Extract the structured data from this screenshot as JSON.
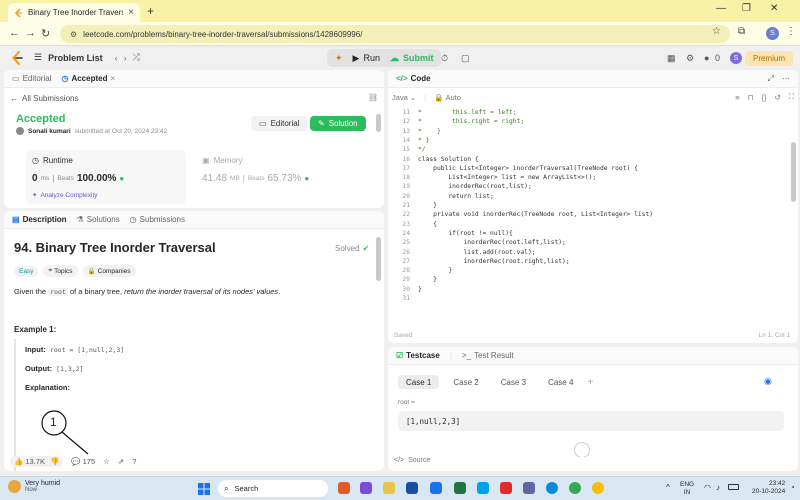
{
  "browser": {
    "tab_title": "Binary Tree Inorder Traversal",
    "url": "leetcode.com/problems/binary-tree-inorder-traversal/submissions/1428609996/",
    "avatar_letter": "S",
    "tab_close": "×",
    "new_tab": "+",
    "win_min": "—",
    "win_max": "❐",
    "win_close": "✕"
  },
  "lc_header": {
    "problem_list": "Problem List",
    "run": "Run",
    "submit": "Submit",
    "coins": "0",
    "premium": "Premium",
    "avatar_letter": "S"
  },
  "submission": {
    "tabs": [
      "Editorial",
      "Accepted"
    ],
    "tab_close": "×",
    "back_link": "All Submissions",
    "status": "Accepted",
    "author": "Sonali kumari",
    "submitted_text": "submitted at Oct 20, 2024 23:42",
    "editorial_btn": "Editorial",
    "solution_btn": "Solution",
    "runtime_label": "Runtime",
    "runtime_value": "0",
    "runtime_unit": "ms",
    "beats_label": "Beats",
    "runtime_beats": "100.00%",
    "analyze": "Analyze Complexity",
    "memory_label": "Memory",
    "memory_value": "41.48",
    "memory_unit": "MB",
    "memory_beats": "65.73%"
  },
  "description": {
    "tabs": [
      "Description",
      "Solutions",
      "Submissions"
    ],
    "title": "94. Binary Tree Inorder Traversal",
    "solved": "Solved",
    "tags": [
      "Easy",
      "Topics",
      "Companies"
    ],
    "stmt_1": "Given the",
    "stmt_code": "root",
    "stmt_2": "of a binary tree,",
    "stmt_3": "return the inorder traversal of its nodes' values",
    "stmt_4": ".",
    "example_title": "Example 1:",
    "input_label": "Input:",
    "input_value": "root = [1,null,2,3]",
    "output_label": "Output:",
    "output_value": "[1,3,2]",
    "explanation_label": "Explanation:",
    "tree_node": "1",
    "likes": "13.7K",
    "comments": "175"
  },
  "code": {
    "title": "Code",
    "language": "Java",
    "mode": "Auto",
    "status_saved": "Saved",
    "cursor": "Ln 1, Col 1",
    "line_numbers": [
      "11",
      "12",
      "13",
      "14",
      "15",
      "16",
      "17",
      "18",
      "19",
      "20",
      "21",
      "22",
      "23",
      "24",
      "25",
      "26",
      "27",
      "28",
      "29",
      "30",
      "31"
    ],
    "lines": [
      "*        this.left = left;",
      "*        this.right = right;",
      "*    }",
      "* }",
      "*/",
      "class Solution {",
      "    public List<Integer> inorderTraversal(TreeNode root) {",
      "        List<Integer> list = new ArrayList<>();",
      "        inorderRec(root,list);",
      "        return list;",
      "    }",
      "    private void inorderRec(TreeNode root, List<Integer> list)",
      "    {",
      "        if(root != null){",
      "            inorderRec(root.left,list);",
      "            list.add(root.val);",
      "            inorderRec(root.right,list);",
      "        }",
      "    }",
      "}",
      ""
    ]
  },
  "testcase": {
    "tab_testcase": "Testcase",
    "tab_result": "Test Result",
    "cases": [
      "Case 1",
      "Case 2",
      "Case 3",
      "Case 4"
    ],
    "add_case": "+",
    "var_label": "root =",
    "var_value": "[1,null,2,3]",
    "source": "Source"
  },
  "taskbar": {
    "weather_title": "Very humid",
    "weather_sub": "Now",
    "search": "Search",
    "lang_1": "ENG",
    "lang_2": "IN",
    "time": "23:42",
    "date": "20-10-2024"
  }
}
